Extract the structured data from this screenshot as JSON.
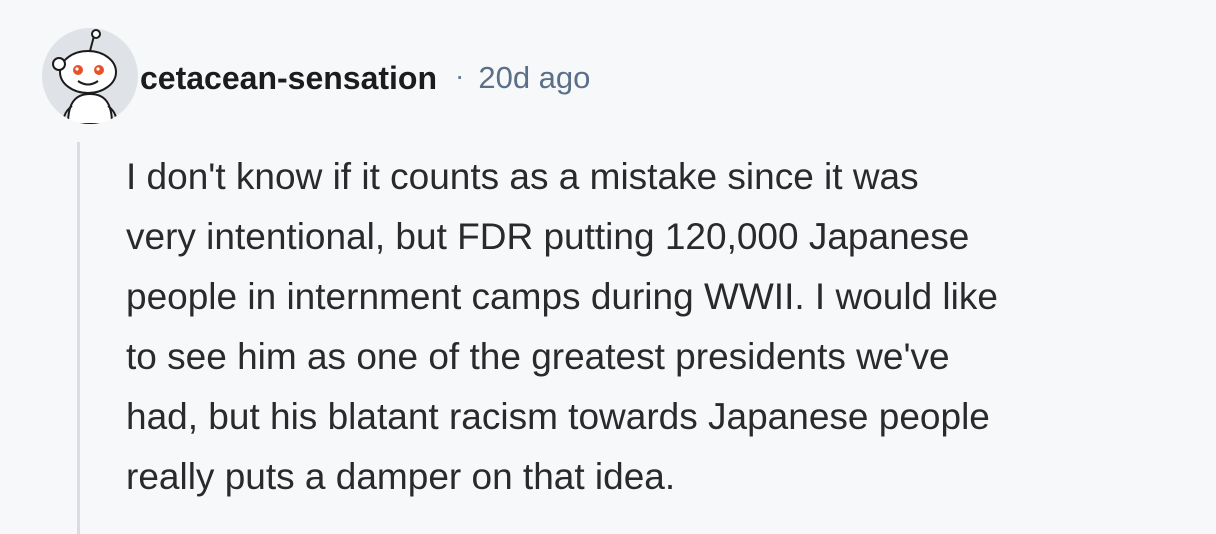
{
  "comment": {
    "author": "cetacean-sensation",
    "separator": "·",
    "timestamp": "20d ago",
    "body_lines": [
      "I don't know if it counts as a mistake since it was",
      "very intentional, but FDR putting 120,000 Japanese",
      "people in internment camps during WWII. I would like",
      "to see him as one of the greatest presidents we've",
      "had, but his blatant racism towards Japanese people",
      "really puts a damper on that idea."
    ]
  },
  "avatar": {
    "icon": "reddit-snoo-icon",
    "background_color": "#dfe3e8",
    "eye_color": "#e8502a"
  },
  "colors": {
    "page_background": "#f7f8fa",
    "thread_line": "#d9dde3",
    "username": "#1c1c1c",
    "timestamp": "#5c6f88",
    "body_text": "#2a2a2a"
  }
}
